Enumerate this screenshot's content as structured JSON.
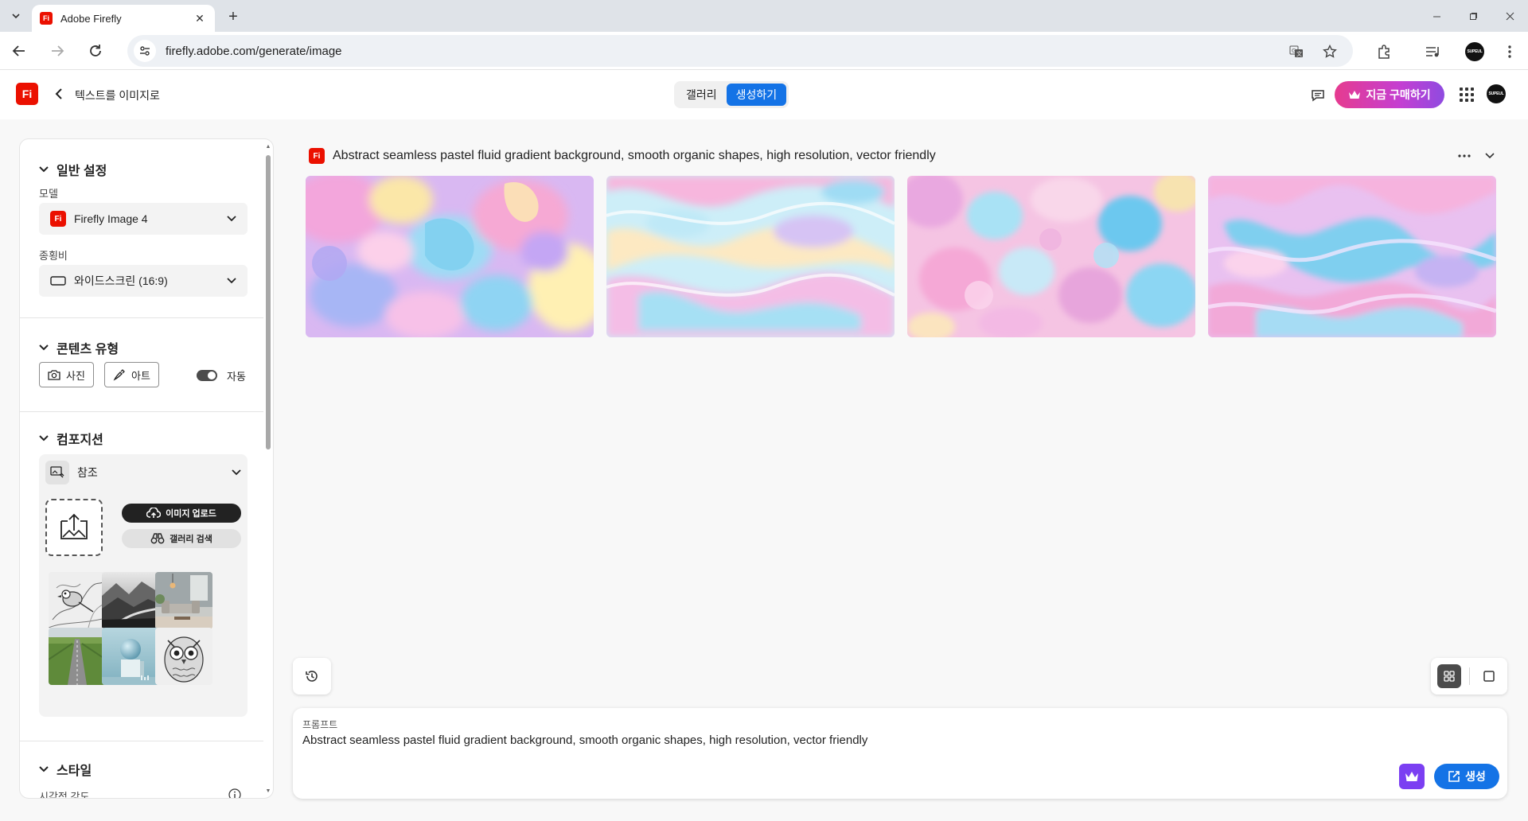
{
  "browser": {
    "tab_title": "Adobe Firefly",
    "favicon_text": "Fi",
    "url": "firefly.adobe.com/generate/image",
    "profile_text": "SUPEUL"
  },
  "header": {
    "logo_text": "Fi",
    "title": "텍스트를 이미지로",
    "nav": [
      {
        "label": "갤러리",
        "active": false
      },
      {
        "label": "생성하기",
        "active": true
      }
    ],
    "buy_label": "지금 구매하기",
    "avatar_text": "SUPEUL"
  },
  "panel": {
    "general": {
      "heading": "일반 설정",
      "model_label": "모델",
      "model_value": "Firefly Image 4",
      "ratio_label": "종횡비",
      "ratio_value": "와이드스크린 (16:9)"
    },
    "content_type": {
      "heading": "콘텐츠 유형",
      "photo_label": "사진",
      "art_label": "아트",
      "auto_label": "자동",
      "auto_on": true
    },
    "composition": {
      "heading": "컴포지션",
      "reference_label": "참조",
      "upload_label": "이미지 업로드",
      "gallery_search_label": "갤러리 검색",
      "thumbnails": [
        "bird-sketch",
        "misty-mountains",
        "living-room",
        "green-road",
        "sphere-on-cube",
        "owl-sketch"
      ]
    },
    "style": {
      "heading": "스타일",
      "visual_intensity_label": "시각적 강도"
    }
  },
  "result": {
    "badge_text": "Fi",
    "title": "Abstract seamless pastel fluid gradient background, smooth organic shapes, high resolution, vector friendly"
  },
  "prompt": {
    "label": "프롬프트",
    "text": "Abstract seamless pastel fluid gradient background, smooth organic shapes, high resolution, vector friendly",
    "generate_label": "생성"
  },
  "colors": {
    "brand_red": "#eb1000",
    "accent_blue": "#1473e6",
    "premium_purple": "#7b3ff2"
  }
}
